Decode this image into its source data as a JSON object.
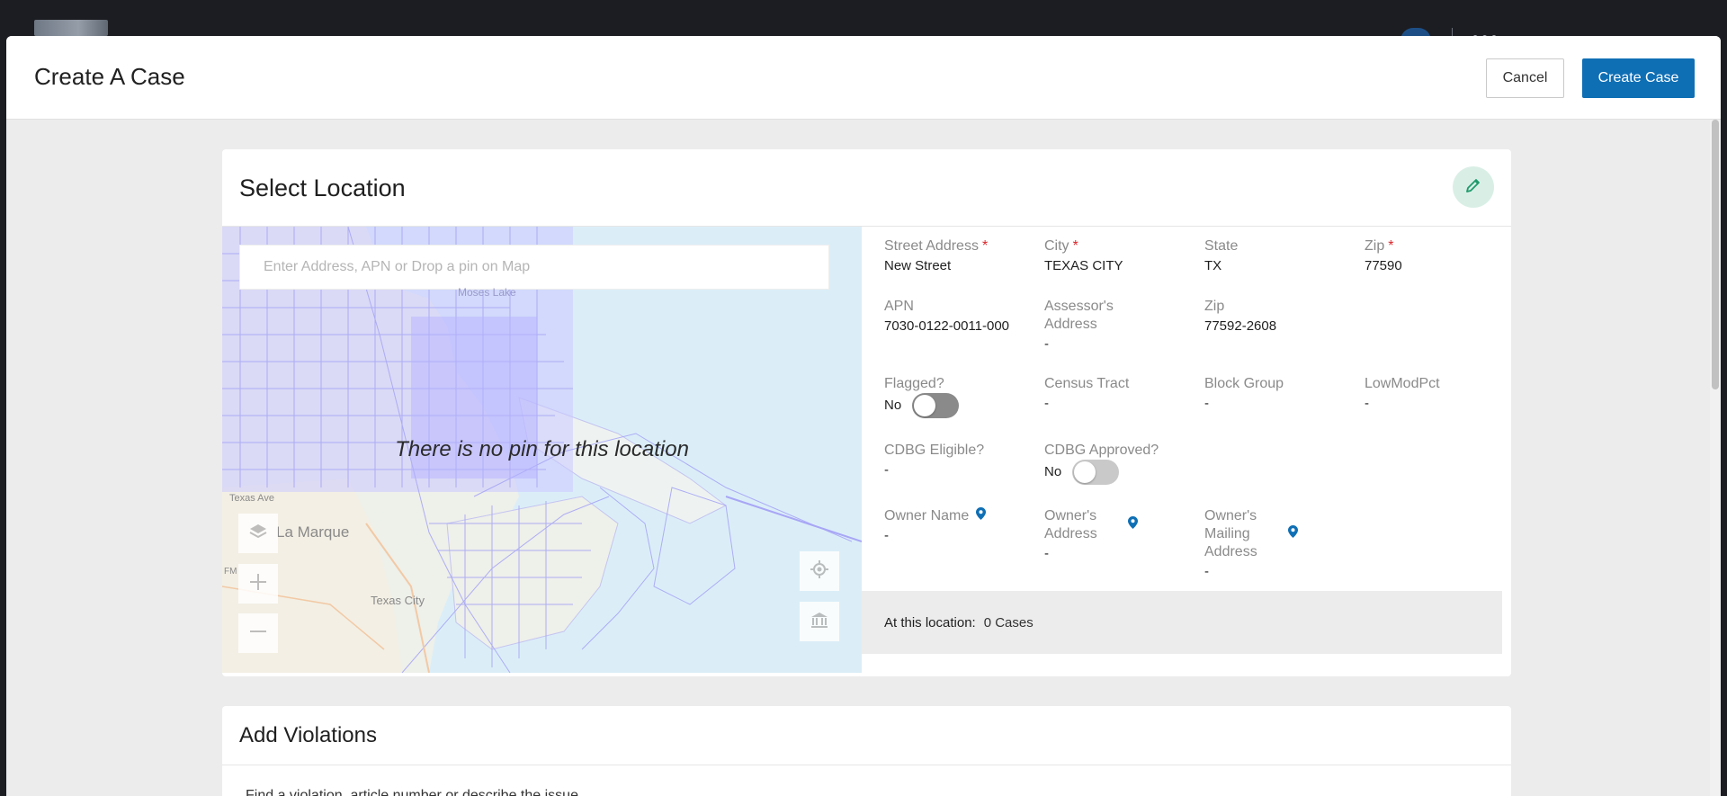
{
  "modal": {
    "title": "Create A Case",
    "cancel_label": "Cancel",
    "create_label": "Create Case",
    "accent_color": "#0f6fb5"
  },
  "location": {
    "title": "Select Location",
    "search_placeholder": "Enter Address, APN or Drop a pin on Map",
    "no_pin_message": "There is no pin for this location",
    "map_labels": [
      "La Marque",
      "Texas City",
      "Moses Lake",
      "Texas Ave",
      "FM"
    ],
    "fields": {
      "street_address": {
        "label": "Street Address",
        "value": "New Street",
        "required": "*"
      },
      "city": {
        "label": "City",
        "value": "TEXAS CITY",
        "required": "*"
      },
      "state": {
        "label": "State",
        "value": "TX"
      },
      "zip": {
        "label": "Zip",
        "value": "77590",
        "required": "*"
      },
      "apn": {
        "label": "APN",
        "value": "7030-0122-0011-000"
      },
      "assessors_address": {
        "label": "Assessor's Address",
        "value": "-"
      },
      "zip2": {
        "label": "Zip",
        "value": "77592-2608"
      },
      "flagged": {
        "label": "Flagged?",
        "value": "No"
      },
      "census_tract": {
        "label": "Census Tract",
        "value": "-"
      },
      "block_group": {
        "label": "Block Group",
        "value": "-"
      },
      "lowmodpct": {
        "label": "LowModPct",
        "value": "-"
      },
      "cdbg_eligible": {
        "label": "CDBG Eligible?",
        "value": "-"
      },
      "cdbg_approved": {
        "label": "CDBG Approved?",
        "value": "No"
      },
      "owner_name": {
        "label": "Owner Name",
        "value": "-"
      },
      "owners_address": {
        "label": "Owner's Address",
        "value": "-"
      },
      "owners_mailing_address": {
        "label": "Owner's Mailing Address",
        "value": "-"
      }
    },
    "at_location_label": "At this location:",
    "at_location_value": "0 Cases"
  },
  "violations": {
    "title": "Add Violations",
    "hint": "Find a violation, article number or describe the issue"
  }
}
